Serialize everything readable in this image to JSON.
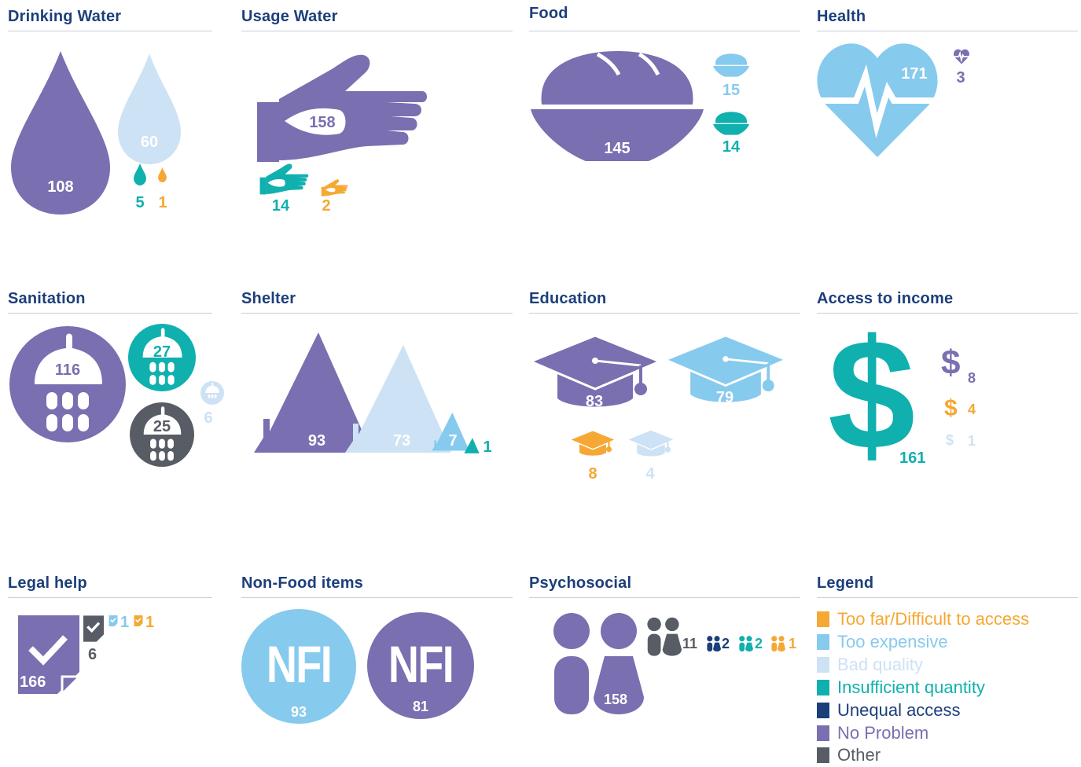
{
  "colors": {
    "too_far": "#f5a833",
    "too_expensive": "#86caee",
    "bad_quality": "#cde2f4",
    "insufficient_quantity": "#10b0ae",
    "unequal_access": "#1c3f7a",
    "no_problem": "#7a6fb0",
    "other": "#585c64",
    "title": "#1c3f7a"
  },
  "panels": {
    "drinking_water": {
      "title": "Drinking Water",
      "values": {
        "no_problem": "108",
        "bad_quality": "60",
        "insufficient_quantity": "5",
        "too_far": "1"
      }
    },
    "usage_water": {
      "title": "Usage Water",
      "values": {
        "no_problem": "158",
        "insufficient_quantity": "14",
        "too_far": "2"
      }
    },
    "food": {
      "title": "Food",
      "values": {
        "no_problem": "145",
        "too_expensive": "15",
        "insufficient_quantity": "14"
      }
    },
    "health": {
      "title": "Health",
      "values": {
        "too_expensive": "171",
        "no_problem": "3"
      }
    },
    "sanitation": {
      "title": "Sanitation",
      "values": {
        "no_problem": "116",
        "insufficient_quantity": "27",
        "other": "25",
        "bad_quality": "6"
      }
    },
    "shelter": {
      "title": "Shelter",
      "values": {
        "no_problem": "93",
        "bad_quality": "73",
        "too_expensive": "7",
        "insufficient_quantity": "1"
      }
    },
    "education": {
      "title": "Education",
      "values": {
        "no_problem": "83",
        "too_expensive": "79",
        "too_far": "8",
        "bad_quality": "4"
      }
    },
    "income": {
      "title": "Access to income",
      "values": {
        "insufficient_quantity": "161",
        "no_problem": "8",
        "too_far": "4",
        "bad_quality": "1"
      }
    },
    "legal": {
      "title": "Legal help",
      "values": {
        "no_problem": "166",
        "other": "6",
        "too_expensive": "1",
        "too_far": "1"
      }
    },
    "nfi": {
      "title": "Non-Food items",
      "icon_text": "NFI",
      "values": {
        "too_expensive": "93",
        "no_problem": "81"
      }
    },
    "psychosocial": {
      "title": "Psychosocial",
      "values": {
        "no_problem": "158",
        "other": "11",
        "unequal_access": "2",
        "insufficient_quantity": "2",
        "too_far": "1"
      }
    }
  },
  "legend": {
    "title": "Legend",
    "items": [
      {
        "key": "too_far",
        "label": "Too far/Difficult to access"
      },
      {
        "key": "too_expensive",
        "label": "Too expensive"
      },
      {
        "key": "bad_quality",
        "label": "Bad quality"
      },
      {
        "key": "insufficient_quantity",
        "label": "Insufficient quantity"
      },
      {
        "key": "unequal_access",
        "label": "Unequal access"
      },
      {
        "key": "no_problem",
        "label": "No Problem"
      },
      {
        "key": "other",
        "label": "Other"
      }
    ]
  }
}
